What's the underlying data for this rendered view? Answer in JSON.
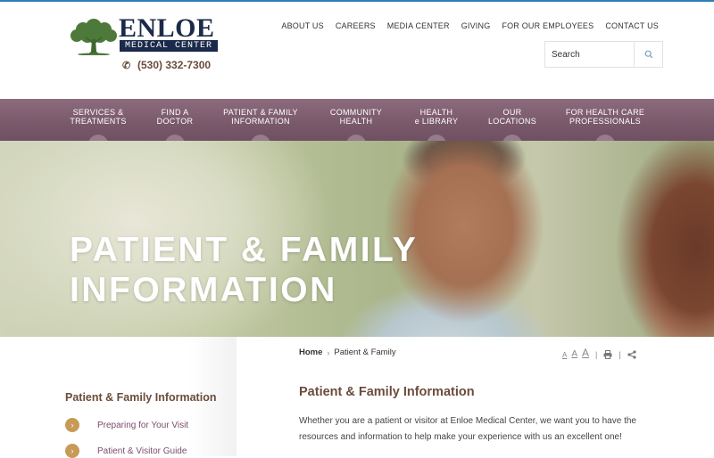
{
  "brand": {
    "name": "ENLOE",
    "sub": "MEDICAL CENTER",
    "phone": "(530) 332-7300",
    "colors": {
      "navy": "#1b2a4a",
      "brown": "#6b4c3b",
      "plum": "#7a5a6b",
      "gold": "#c79b56",
      "green": "#4d7a3a"
    }
  },
  "util_nav": [
    "ABOUT US",
    "CAREERS",
    "MEDIA CENTER",
    "GIVING",
    "FOR OUR EMPLOYEES",
    "CONTACT US"
  ],
  "search": {
    "placeholder": "Search",
    "icon": "search-icon"
  },
  "main_nav": [
    {
      "line1": "SERVICES &",
      "line2": "TREATMENTS"
    },
    {
      "line1": "FIND A",
      "line2": "DOCTOR"
    },
    {
      "line1": "PATIENT & FAMILY",
      "line2": "INFORMATION"
    },
    {
      "line1": "COMMUNITY",
      "line2": "HEALTH"
    },
    {
      "line1": "HEALTH",
      "line2": "e LIBRARY"
    },
    {
      "line1": "OUR",
      "line2": "LOCATIONS"
    },
    {
      "line1": "FOR HEALTH CARE",
      "line2": "PROFESSIONALS"
    }
  ],
  "hero": {
    "line1": "PATIENT & FAMILY",
    "line2": "INFORMATION"
  },
  "breadcrumb": {
    "home": "Home",
    "current": "Patient & Family"
  },
  "tools": {
    "font_small": "A",
    "font_medium": "A",
    "font_large": "A",
    "print_icon": "printer-icon",
    "share_icon": "share-icon"
  },
  "sidebar": {
    "title": "Patient & Family Information",
    "items": [
      {
        "label": "Preparing for Your Visit",
        "bullet": "›"
      },
      {
        "label": "Patient & Visitor Guide",
        "bullet": "›"
      }
    ]
  },
  "content": {
    "title": "Patient & Family Information",
    "intro": "Whether you are a patient or visitor at Enloe Medical Center, we want you to have the resources and information to help make your experience with us an excellent one!"
  }
}
